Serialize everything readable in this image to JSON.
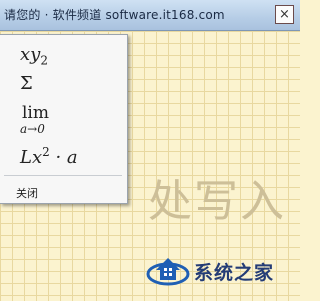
{
  "titlebar": {
    "title": "请您的 · 软件频道 software.it168.com",
    "close_symbol": "×"
  },
  "canvas": {
    "hint_text": "处写入"
  },
  "menu": {
    "item1": {
      "base": "xy",
      "sub": "2"
    },
    "item2": {
      "text": "Σ"
    },
    "item3": {
      "op": "lim",
      "sub": "a→0"
    },
    "item4": {
      "base": "Lx",
      "sup": "2",
      "rest": " · a"
    },
    "close_label": "关闭"
  },
  "logo": {
    "text": "系统之家",
    "colors": {
      "blue": "#1f5fb4",
      "dark": "#243c76"
    }
  }
}
